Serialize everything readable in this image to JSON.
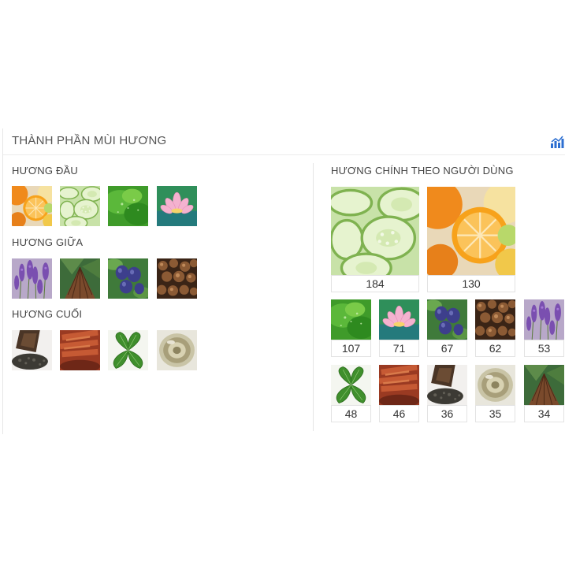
{
  "panel": {
    "title": "THÀNH PHẦN MÙI HƯƠNG",
    "chart_icon": "bar-chart-icon"
  },
  "notes": {
    "top": {
      "label": "HƯƠNG ĐẦU",
      "items": [
        "orange",
        "cucumber",
        "green-leaves",
        "lotus"
      ]
    },
    "middle": {
      "label": "HƯƠNG GIỮA",
      "items": [
        "lavender",
        "cedar-wood",
        "plum",
        "nutmeg"
      ]
    },
    "base": {
      "label": "HƯƠNG CUỐI",
      "items": [
        "tea",
        "red-sandalwood",
        "mint",
        "amber"
      ]
    }
  },
  "main_notes": {
    "label": "HƯƠNG CHÍNH THEO NGƯỜI DÙNG",
    "large": [
      {
        "image": "cucumber",
        "count": "184"
      },
      {
        "image": "orange",
        "count": "130"
      }
    ],
    "small": [
      {
        "image": "green-leaves",
        "count": "107"
      },
      {
        "image": "lotus",
        "count": "71"
      },
      {
        "image": "plum",
        "count": "67"
      },
      {
        "image": "nutmeg",
        "count": "62"
      },
      {
        "image": "lavender",
        "count": "53"
      },
      {
        "image": "mint",
        "count": "48"
      },
      {
        "image": "red-sandalwood",
        "count": "46"
      },
      {
        "image": "tea",
        "count": "36"
      },
      {
        "image": "amber",
        "count": "35"
      },
      {
        "image": "cedar-wood",
        "count": "34"
      }
    ]
  }
}
